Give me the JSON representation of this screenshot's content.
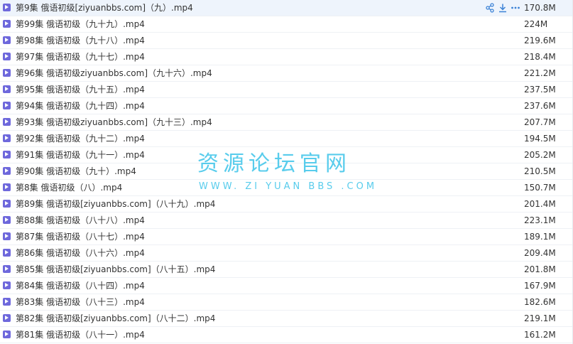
{
  "files": [
    {
      "name": "第9集 俄语初级[ziyuanbbs.com]（九）.mp4",
      "size": "170.8M"
    },
    {
      "name": "第99集 俄语初级（九十九）.mp4",
      "size": "224M"
    },
    {
      "name": "第98集 俄语初级（九十八）.mp4",
      "size": "219.6M"
    },
    {
      "name": "第97集 俄语初级（九十七）.mp4",
      "size": "218.4M"
    },
    {
      "name": "第96集 俄语初级ziyuanbbs.com]（九十六）.mp4",
      "size": "221.2M"
    },
    {
      "name": "第95集 俄语初级（九十五）.mp4",
      "size": "237.5M"
    },
    {
      "name": "第94集 俄语初级（九十四）.mp4",
      "size": "237.6M"
    },
    {
      "name": "第93集 俄语初级ziyuanbbs.com]（九十三）.mp4",
      "size": "207.7M"
    },
    {
      "name": "第92集 俄语初级（九十二）.mp4",
      "size": "194.5M"
    },
    {
      "name": "第91集 俄语初级（九十一）.mp4",
      "size": "205.2M"
    },
    {
      "name": "第90集 俄语初级（九十）.mp4",
      "size": "210.5M"
    },
    {
      "name": "第8集 俄语初级（八）.mp4",
      "size": "150.7M"
    },
    {
      "name": "第89集 俄语初级[ziyuanbbs.com]（八十九）.mp4",
      "size": "201.4M"
    },
    {
      "name": "第88集 俄语初级（八十八）.mp4",
      "size": "223.1M"
    },
    {
      "name": "第87集 俄语初级（八十七）.mp4",
      "size": "189.1M"
    },
    {
      "name": "第86集 俄语初级（八十六）.mp4",
      "size": "209.4M"
    },
    {
      "name": "第85集 俄语初级[ziyuanbbs.com]（八十五）.mp4",
      "size": "201.8M"
    },
    {
      "name": "第84集 俄语初级（八十四）.mp4",
      "size": "167.9M"
    },
    {
      "name": "第83集 俄语初级（八十三）.mp4",
      "size": "182.6M"
    },
    {
      "name": "第82集 俄语初级[ziyuanbbs.com]（八十二）.mp4",
      "size": "219.1M"
    },
    {
      "name": "第81集 俄语初级（八十一）.mp4",
      "size": "161.2M"
    }
  ],
  "row_actions": {
    "share_icon": "share-icon",
    "download_icon": "download-icon",
    "more_icon": "more-icon"
  },
  "watermark": {
    "title": "资源论坛官网",
    "subtitle": "WWW. ZI YUAN BBS .COM"
  },
  "colors": {
    "file_icon": "#6e68dc",
    "watermark": "#47c7ea",
    "hover_row": "#eef4fc",
    "action_icon": "#3b82d6"
  }
}
